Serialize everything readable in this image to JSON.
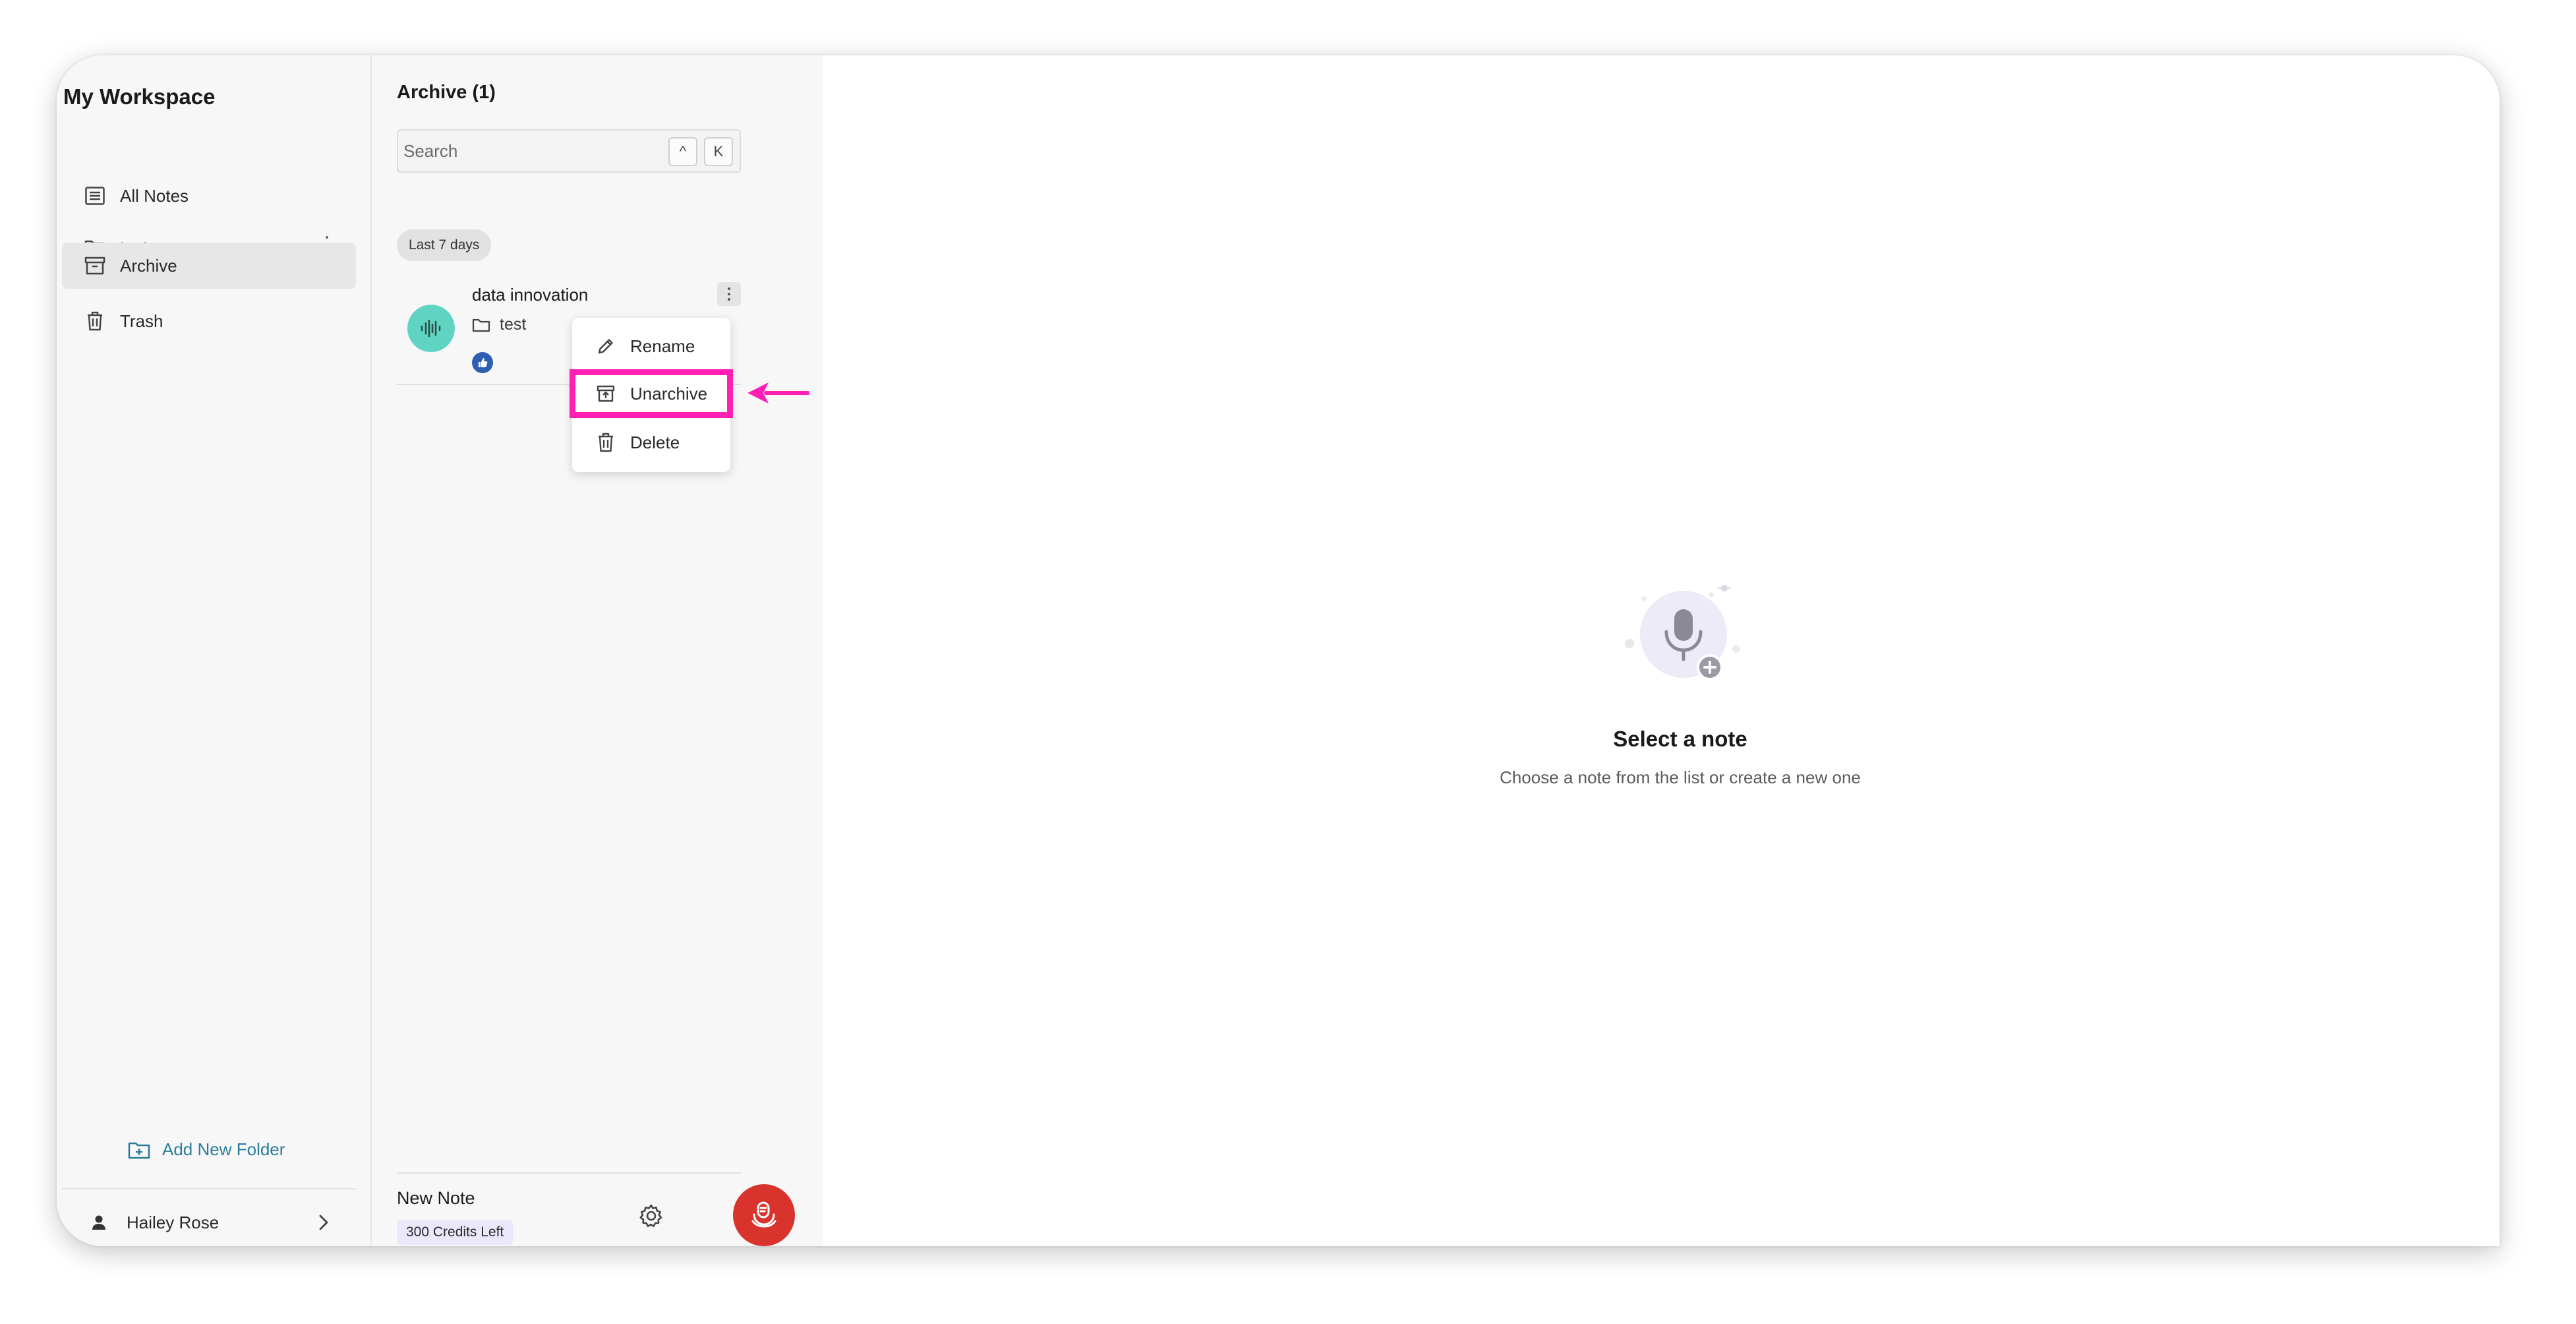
{
  "sidebar": {
    "workspace_title": "My Workspace",
    "items": [
      {
        "label": "All Notes",
        "icon": "list-icon"
      },
      {
        "label": "test",
        "icon": "folder-icon"
      },
      {
        "label": "Archive",
        "icon": "archive-icon",
        "active": true
      },
      {
        "label": "Trash",
        "icon": "trash-icon"
      }
    ],
    "add_folder_label": "Add New Folder",
    "user_name": "Hailey Rose"
  },
  "list": {
    "title": "Archive (1)",
    "search_placeholder": "Search",
    "shortcut_keys": [
      "^",
      "K"
    ],
    "group_label": "Last 7 days",
    "note": {
      "title": "data innovation",
      "folder": "test"
    },
    "context_menu": {
      "items": [
        {
          "label": "Rename",
          "icon": "pencil-icon"
        },
        {
          "label": "Unarchive",
          "icon": "unarchive-icon",
          "highlighted": true
        },
        {
          "label": "Delete",
          "icon": "trash-icon"
        }
      ]
    },
    "footer": {
      "new_note_label": "New Note",
      "credits_label": "300 Credits Left"
    }
  },
  "main": {
    "empty_title": "Select a note",
    "empty_subtitle": "Choose a note from the list or create a new one"
  },
  "colors": {
    "accent_teal": "#5fd4c3",
    "record_red": "#d8332c",
    "highlight_pink": "#ff1fb4",
    "link_blue": "#2a7c9c"
  }
}
